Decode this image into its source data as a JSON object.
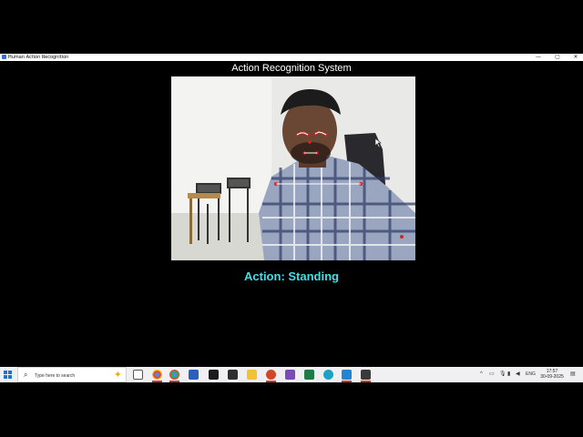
{
  "window": {
    "title": "Human Action Recognition",
    "minimize": "—",
    "maximize": "▢",
    "close": "✕"
  },
  "app": {
    "header": "Action Recognition System",
    "action_prefix": "Action: ",
    "action_value": "Standing",
    "action_color": "#3fe0e8"
  },
  "video": {
    "description_icon": "webcam-feed",
    "landmark_color": "#e02020"
  },
  "taskbar": {
    "search_placeholder": "Type here to search",
    "pinned_icons": [
      "task-view-icon",
      "chrome-icon",
      "chrome-icon",
      "word-icon",
      "photos-icon",
      "terminal-icon",
      "file-explorer-icon",
      "powerpoint-icon",
      "visual-studio-icon",
      "excel-icon",
      "edge-icon",
      "vscode-icon",
      "python-idle-icon"
    ],
    "tray": {
      "chevron": "^",
      "language": "ENG",
      "time": "17:57",
      "date": "30-09-2025"
    }
  }
}
